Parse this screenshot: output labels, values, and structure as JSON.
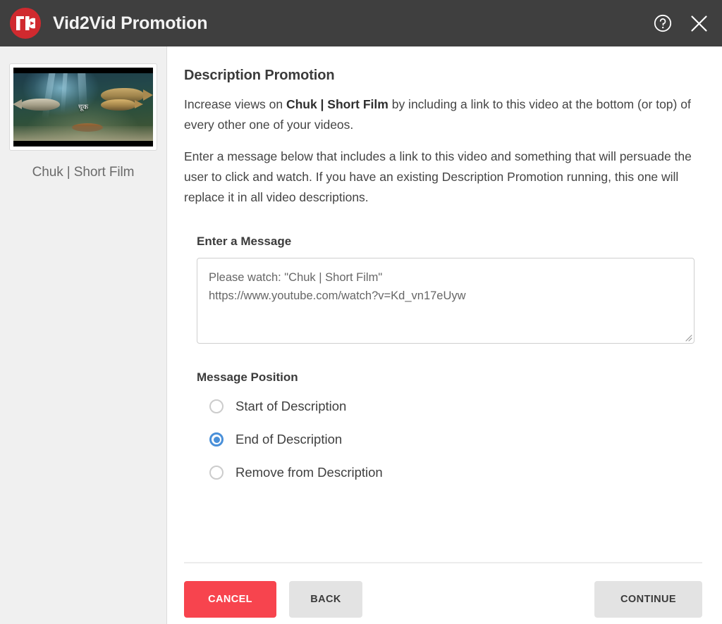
{
  "header": {
    "title": "Vid2Vid Promotion",
    "logo_alt": "tubebuddy-logo",
    "help_icon": "help-circle-icon",
    "close_icon": "close-icon",
    "background_color": "#3f3f3f",
    "logo_color": "#d02a2f"
  },
  "sidebar": {
    "video_title": "Chuk | Short Film",
    "thumbnail_caption": "चूक",
    "background_color": "#f0f0f0"
  },
  "main": {
    "page_title": "Description Promotion",
    "intro": {
      "before": "Increase views on ",
      "video_title": "Chuk | Short Film",
      "after": " by including a link to this video at the bottom (or top) of every other one of your videos."
    },
    "instructions": "Enter a message below that includes a link to this video and something that will persuade the user to click and watch. If you have an existing Description Promotion running, this one will replace it in all video descriptions.",
    "message_field": {
      "label": "Enter a Message",
      "value": "Please watch: \"Chuk | Short Film\"\nhttps://www.youtube.com/watch?v=Kd_vn17eUyw",
      "placeholder": "Enter a message"
    },
    "message_position": {
      "label": "Message Position",
      "selected": "End of Description",
      "accent_color": "#4a90d9",
      "options": [
        {
          "label": "Start of Description",
          "checked": false
        },
        {
          "label": "End of Description",
          "checked": true
        },
        {
          "label": "Remove from Description",
          "checked": false
        }
      ]
    }
  },
  "footer": {
    "cancel_label": "CANCEL",
    "back_label": "BACK",
    "continue_label": "CONTINUE",
    "cancel_color": "#f7444e",
    "neutral_color": "#e3e3e3"
  }
}
